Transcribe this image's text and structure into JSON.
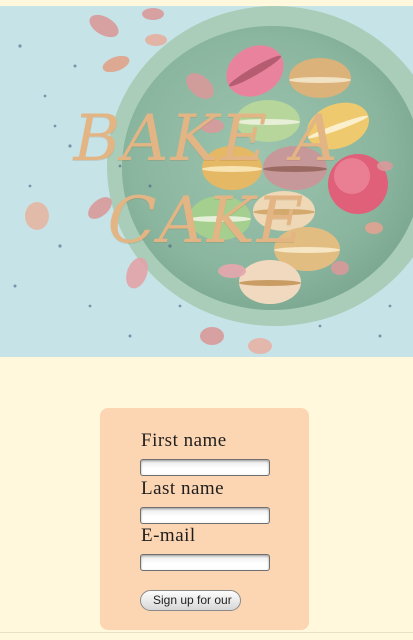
{
  "hero": {
    "title_line1": "BAKE A",
    "title_line2": "CAKE",
    "image_subject": "macarons on a green plate",
    "colors": {
      "background": "#c6e3e7",
      "plate": "#8fb9a3",
      "title": "#e4b584"
    }
  },
  "form": {
    "first_name_label": "First name",
    "first_name_value": "",
    "last_name_label": "Last name",
    "last_name_value": "",
    "email_label": "E-mail",
    "email_value": "",
    "submit_label": "Sign up for our"
  },
  "colors": {
    "page_background": "#fff8dc",
    "card_background": "#fcd5b3"
  }
}
